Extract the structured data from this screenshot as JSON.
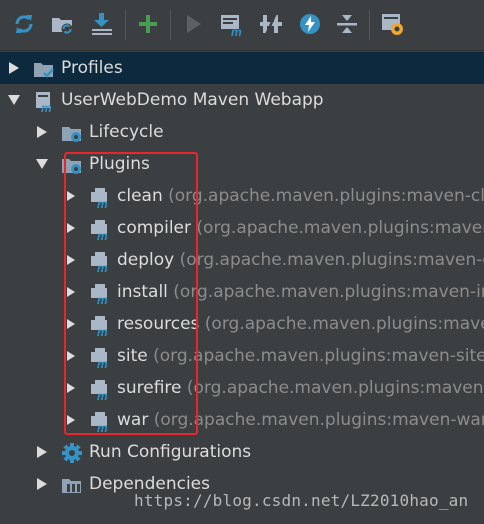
{
  "toolbar": {
    "buttons": [
      {
        "name": "reimport-all-projects-icon"
      },
      {
        "name": "generate-sources-icon"
      },
      {
        "name": "download-sources-icon"
      },
      {
        "name": "add-maven-project-icon"
      },
      {
        "name": "run-maven-build-icon"
      },
      {
        "name": "execute-maven-goal-icon"
      },
      {
        "name": "toggle-offline-mode-icon"
      },
      {
        "name": "toggle-skip-tests-icon"
      },
      {
        "name": "collapse-all-icon"
      },
      {
        "name": "maven-settings-icon"
      }
    ]
  },
  "tree": {
    "profiles": "Profiles",
    "project": "UserWebDemo Maven Webapp",
    "lifecycle": "Lifecycle",
    "plugins": "Plugins",
    "plugin_items": [
      {
        "name": "clean",
        "coords": "(org.apache.maven.plugins:maven-cle"
      },
      {
        "name": "compiler",
        "coords": "(org.apache.maven.plugins:maven"
      },
      {
        "name": "deploy",
        "coords": "(org.apache.maven.plugins:maven-d"
      },
      {
        "name": "install",
        "coords": "(org.apache.maven.plugins:maven-in"
      },
      {
        "name": "resources",
        "coords": "(org.apache.maven.plugins:mave"
      },
      {
        "name": "site",
        "coords": "(org.apache.maven.plugins:maven-site"
      },
      {
        "name": "surefire",
        "coords": "(org.apache.maven.plugins:maven-"
      },
      {
        "name": "war",
        "coords": "(org.apache.maven.plugins:maven-war"
      }
    ],
    "run_configurations": "Run Configurations",
    "dependencies": "Dependencies"
  },
  "watermark": "https://blog.csdn.net/LZ2010hao_an",
  "colors": {
    "background": "#3c3f41",
    "selected_row": "#0d293e",
    "highlight_border": "#e8262b",
    "toolbar_blue": "#3592c4",
    "toolbar_green": "#499c54"
  }
}
